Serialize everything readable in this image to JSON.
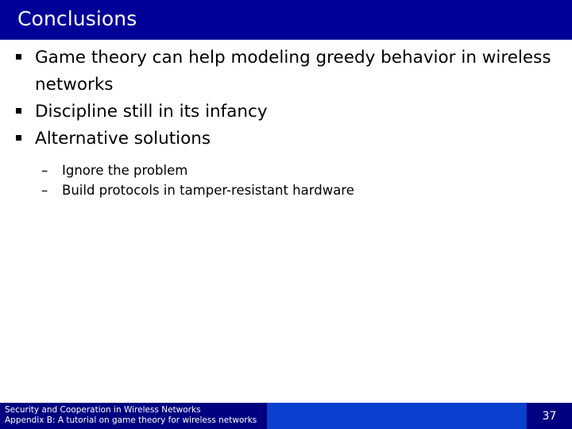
{
  "slide": {
    "title": "Conclusions",
    "theme": {
      "title_bar_color": "#000099",
      "body_background": "#ffffff",
      "body_text_color": "#000000",
      "footer_dark_color": "#000080",
      "footer_bright_color": "#0b3fce",
      "footer_text_color": "#ffffff"
    },
    "bullets": [
      {
        "level": 1,
        "marker": "square-bullet",
        "text": "Game theory can help modeling greedy behavior in wireless networks"
      },
      {
        "level": 1,
        "marker": "square-bullet",
        "text": "Discipline still in its infancy"
      },
      {
        "level": 1,
        "marker": "square-bullet",
        "text": "Alternative solutions"
      }
    ],
    "sub_bullets": [
      {
        "level": 2,
        "marker": "–",
        "text": "Ignore the problem"
      },
      {
        "level": 2,
        "marker": "–",
        "text": "Build protocols in tamper-resistant hardware"
      }
    ]
  },
  "footer": {
    "line1": "Security and Cooperation in Wireless Networks",
    "line2": "Appendix B: A tutorial on game theory for wireless networks",
    "page_number": "37"
  }
}
